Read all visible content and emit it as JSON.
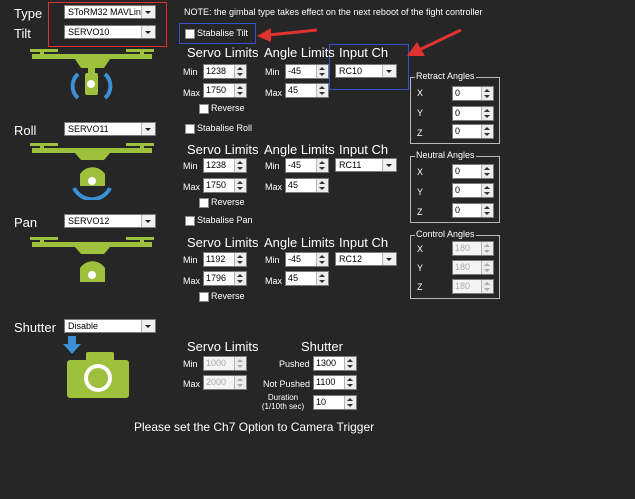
{
  "colors": {
    "background": "#262626",
    "drone_green": "#9dc13c",
    "arrow_blue": "#3b8fd6",
    "annotation_red": "#e0322f",
    "annotation_blue": "#3a4fd0"
  },
  "icons": {
    "tilt": "drone-tilt-icon",
    "roll": "drone-roll-icon",
    "pan": "drone-pan-icon",
    "shutter": "camera-icon"
  },
  "header": {
    "type_label": "Type",
    "type_value": "SToRM32 MAVLink",
    "tilt_label": "Tilt",
    "tilt_value": "SERVO10",
    "note": "NOTE: the gimbal type takes effect on the next reboot of the fight controller"
  },
  "tilt": {
    "stabilise_label": "Stabalise Tilt",
    "servo_limits": "Servo Limits",
    "angle_limits": "Angle Limits",
    "input_ch": "Input Ch",
    "servo_min_label": "Min",
    "servo_min": "1238",
    "servo_max_label": "Max",
    "servo_max": "1750",
    "angle_min_label": "Min",
    "angle_min": "-45",
    "angle_max_label": "Max",
    "angle_max": "45",
    "input_value": "RC10",
    "reverse_label": "Reverse"
  },
  "roll": {
    "label": "Roll",
    "value": "SERVO11",
    "stabilise_label": "Stabalise Roll",
    "servo_limits": "Servo Limits",
    "angle_limits": "Angle Limits",
    "input_ch": "Input Ch",
    "servo_min_label": "Min",
    "servo_min": "1238",
    "servo_max_label": "Max",
    "servo_max": "1750",
    "angle_min_label": "Min",
    "angle_min": "-45",
    "angle_max_label": "Max",
    "angle_max": "45",
    "input_value": "RC11",
    "reverse_label": "Reverse"
  },
  "pan": {
    "label": "Pan",
    "value": "SERVO12",
    "stabilise_label": "Stabalise Pan",
    "servo_limits": "Servo Limits",
    "angle_limits": "Angle Limits",
    "input_ch": "Input Ch",
    "servo_min_label": "Min",
    "servo_min": "1192",
    "servo_max_label": "Max",
    "servo_max": "1796",
    "angle_min_label": "Min",
    "angle_min": "-45",
    "angle_max_label": "Max",
    "angle_max": "45",
    "input_value": "RC12",
    "reverse_label": "Reverse"
  },
  "retract": {
    "title": "Retract Angles",
    "x_label": "X",
    "x": "0",
    "y_label": "Y",
    "y": "0",
    "z_label": "Z",
    "z": "0"
  },
  "neutral": {
    "title": "Neutral Angles",
    "x_label": "X",
    "x": "0",
    "y_label": "Y",
    "y": "0",
    "z_label": "Z",
    "z": "0"
  },
  "control": {
    "title": "Control Angles",
    "x_label": "X",
    "x": "180",
    "y_label": "Y",
    "y": "180",
    "z_label": "Z",
    "z": "180"
  },
  "shutter": {
    "label": "Shutter",
    "value": "Disable",
    "servo_limits": "Servo Limits",
    "shutter_title": "Shutter",
    "min_label": "Min",
    "min": "1000",
    "max_label": "Max",
    "max": "2000",
    "pushed_label": "Pushed",
    "pushed": "1300",
    "not_pushed_label": "Not Pushed",
    "not_pushed": "1100",
    "duration_label": "Duration",
    "duration_unit": "(1/10th sec)",
    "duration": "10"
  },
  "footer": "Please set the Ch7 Option to Camera Trigger"
}
